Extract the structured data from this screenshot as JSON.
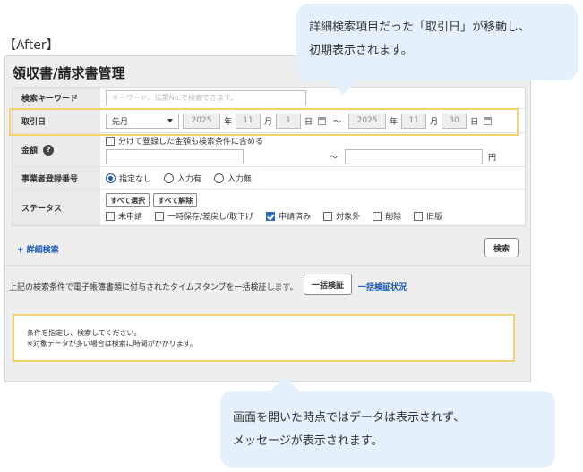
{
  "after_label": "【After】",
  "callout_top": {
    "line1": "詳細検索項目だった「取引日」が移動し、",
    "line2": "初期表示されます。"
  },
  "callout_bottom": {
    "line1": "画面を開いた時点ではデータは表示されず、",
    "line2": "メッセージが表示されます。"
  },
  "page_title": "領収書/請求書管理",
  "keyword": {
    "label": "検索キーワード",
    "placeholder": "キーワード、伝票No.で検索できます。"
  },
  "date": {
    "label": "取引日",
    "period_select": "先月",
    "from": {
      "year": "2025",
      "month": "11",
      "day": "1"
    },
    "to": {
      "year": "2025",
      "month": "11",
      "day": "30"
    },
    "year_unit": "年",
    "month_unit": "月",
    "day_unit": "日",
    "tilde": "～"
  },
  "amount": {
    "label": "金額",
    "help_icon": "?",
    "split_checkbox_label": "分けて登録した金額も検索条件に含める",
    "tilde": "～",
    "yen": "円"
  },
  "registration": {
    "label": "事業者登録番号",
    "options": [
      {
        "label": "指定なし",
        "selected": true
      },
      {
        "label": "入力有",
        "selected": false
      },
      {
        "label": "入力無",
        "selected": false
      }
    ]
  },
  "status": {
    "label": "ステータス",
    "select_all": "すべて選択",
    "clear_all": "すべて解除",
    "options": [
      {
        "label": "未申請",
        "checked": false
      },
      {
        "label": "一時保存/差戻し/取下げ",
        "checked": false
      },
      {
        "label": "申請済み",
        "checked": true
      },
      {
        "label": "対象外",
        "checked": false
      },
      {
        "label": "削除",
        "checked": false
      },
      {
        "label": "旧版",
        "checked": false
      }
    ]
  },
  "advanced_search": "+ 詳細検索",
  "search_button": "検索",
  "bulk": {
    "text": "上記の検索条件で電子帳簿書類に付与されたタイムスタンプを一括検証します。",
    "button": "一括検証",
    "link": "一括検証状況"
  },
  "message": {
    "line1": "条件を指定し、検索してください。",
    "line2": "※対象データが多い場合は検索に時間がかかります。"
  },
  "colors": {
    "highlight": "#f3d26e",
    "callout_bg": "#e4f0fb",
    "link": "#1a56b8",
    "check": "#2b6cc4"
  }
}
